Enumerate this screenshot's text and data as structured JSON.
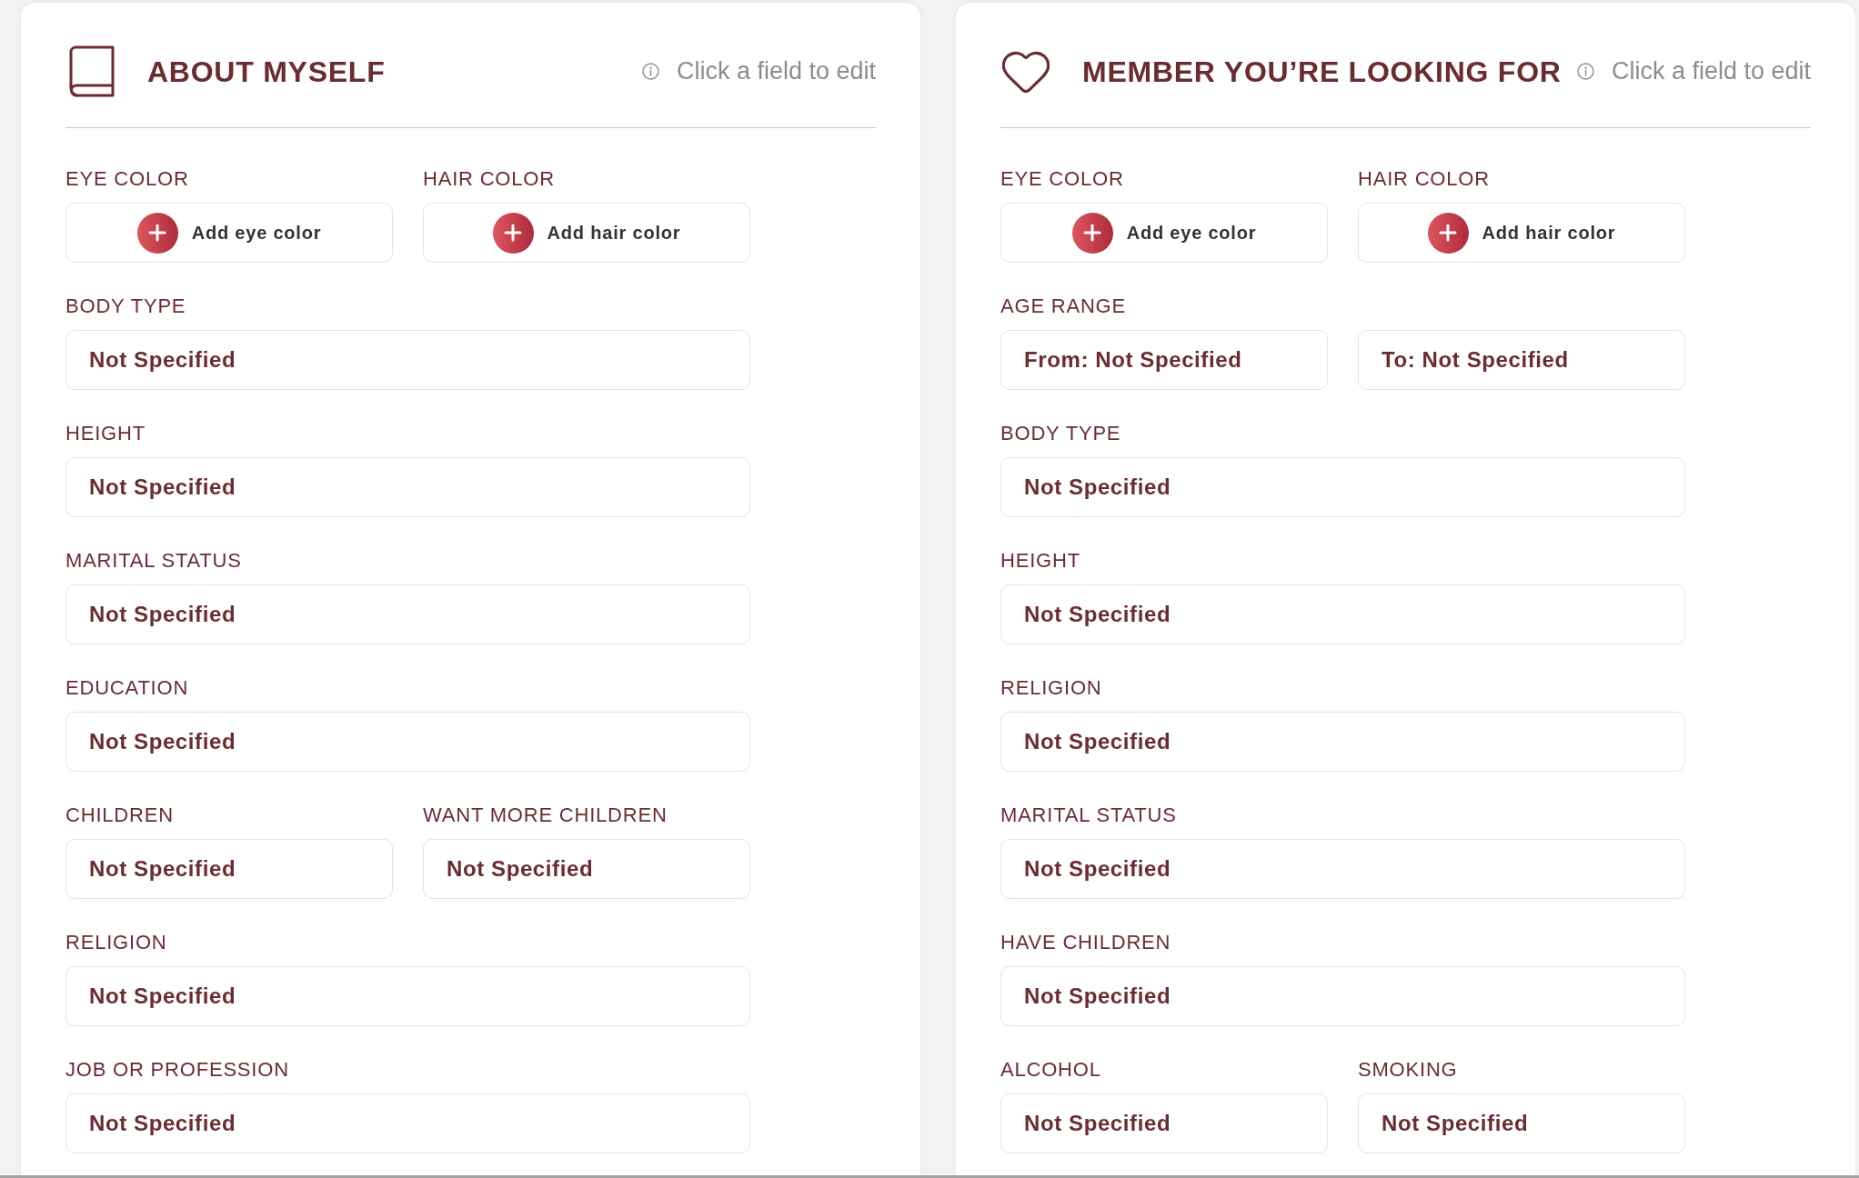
{
  "panels": [
    {
      "title": "ABOUT MYSELF",
      "hint": "Click a field to edit",
      "rows": [
        {
          "fields": [
            {
              "label": "EYE COLOR",
              "kind": "add",
              "text": "Add eye color"
            },
            {
              "label": "HAIR COLOR",
              "kind": "add",
              "text": "Add hair color"
            }
          ]
        },
        {
          "fields": [
            {
              "label": "BODY TYPE",
              "kind": "value",
              "value": "Not Specified"
            }
          ]
        },
        {
          "fields": [
            {
              "label": "HEIGHT",
              "kind": "value",
              "value": "Not Specified"
            }
          ]
        },
        {
          "fields": [
            {
              "label": "MARITAL STATUS",
              "kind": "value",
              "value": "Not Specified"
            }
          ]
        },
        {
          "fields": [
            {
              "label": "EDUCATION",
              "kind": "value",
              "value": "Not Specified"
            }
          ]
        },
        {
          "fields": [
            {
              "label": "CHILDREN",
              "kind": "value",
              "value": "Not Specified"
            },
            {
              "label": "WANT MORE CHILDREN",
              "kind": "value",
              "value": "Not Specified"
            }
          ]
        },
        {
          "fields": [
            {
              "label": "RELIGION",
              "kind": "value",
              "value": "Not Specified"
            }
          ]
        },
        {
          "fields": [
            {
              "label": "JOB OR PROFESSION",
              "kind": "value",
              "value": "Not Specified"
            }
          ]
        }
      ]
    },
    {
      "title": "MEMBER YOU’RE LOOKING FOR",
      "hint": "Click a field to edit",
      "rows": [
        {
          "fields": [
            {
              "label": "EYE COLOR",
              "kind": "add",
              "text": "Add eye color"
            },
            {
              "label": "HAIR COLOR",
              "kind": "add",
              "text": "Add hair color"
            }
          ]
        },
        {
          "fields": [
            {
              "label": "AGE RANGE",
              "kind": "value",
              "value": "From: Not Specified"
            },
            {
              "kind": "value",
              "value": "To: Not Specified"
            }
          ]
        },
        {
          "fields": [
            {
              "label": "BODY TYPE",
              "kind": "value",
              "value": "Not Specified"
            }
          ]
        },
        {
          "fields": [
            {
              "label": "HEIGHT",
              "kind": "value",
              "value": "Not Specified"
            }
          ]
        },
        {
          "fields": [
            {
              "label": "RELIGION",
              "kind": "value",
              "value": "Not Specified"
            }
          ]
        },
        {
          "fields": [
            {
              "label": "MARITAL STATUS",
              "kind": "value",
              "value": "Not Specified"
            }
          ]
        },
        {
          "fields": [
            {
              "label": "HAVE CHILDREN",
              "kind": "value",
              "value": "Not Specified"
            }
          ]
        },
        {
          "fields": [
            {
              "label": "ALCOHOL",
              "kind": "value",
              "value": "Not Specified"
            },
            {
              "label": "SMOKING",
              "kind": "value",
              "value": "Not Specified"
            }
          ]
        }
      ]
    }
  ]
}
